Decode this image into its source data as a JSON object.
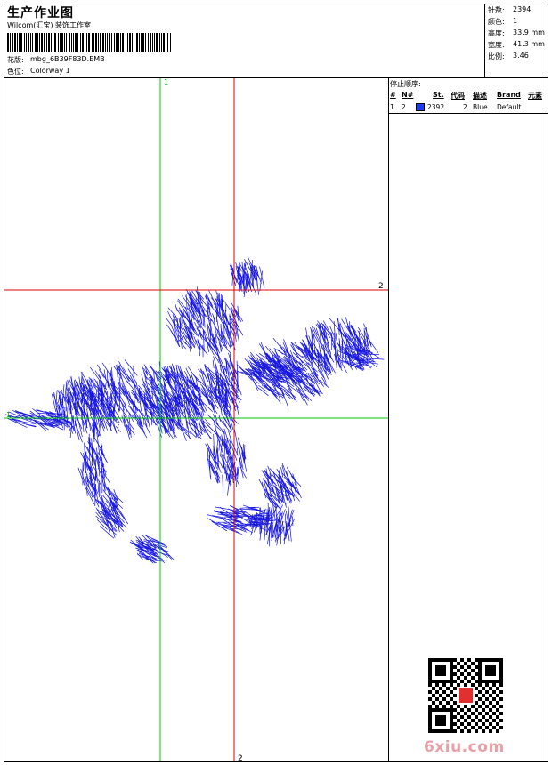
{
  "header": {
    "title": "生产作业图",
    "company": "Wilcom(汇宝) 装饰工作室",
    "design_label": "花版:",
    "design_value": "mbg_6B39F83D.EMB",
    "colorway_label": "色位:",
    "colorway_value": "Colorway 1"
  },
  "stats": [
    {
      "label": "针数:",
      "value": "2394"
    },
    {
      "label": "颜色:",
      "value": "1"
    },
    {
      "label": "高度:",
      "value": "33.9 mm"
    },
    {
      "label": "宽度:",
      "value": "41.3 mm"
    },
    {
      "label": "比例:",
      "value": "3.46"
    }
  ],
  "stop_sequence": {
    "heading": "停止顺序:",
    "columns": [
      "#",
      "N#",
      "St.",
      "代码",
      "描述",
      "Brand",
      "元素"
    ],
    "rows": [
      {
        "idx": "1.",
        "n": "2",
        "swatch_color": "#1e3ce6",
        "stitches": "2392",
        "code": "2",
        "desc": "Blue",
        "brand": "Default",
        "element": ""
      }
    ]
  },
  "canvas": {
    "axis_green_label_top": "1",
    "axis_green_label_left": "1",
    "axis_red_label_right": "2",
    "axis_red_label_bottom": "2",
    "design_color": "#1515e0",
    "green_color": "#00c800",
    "red_color": "#e00000"
  },
  "watermark": "6xiu.com"
}
